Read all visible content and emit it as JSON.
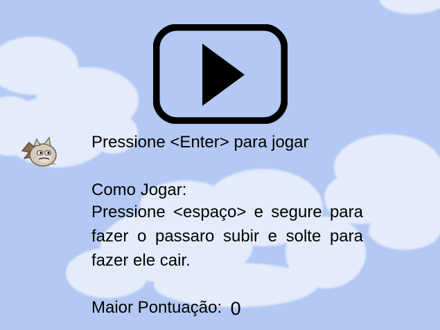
{
  "screen": {
    "type": "start-menu",
    "background_color": "#b3c9f3",
    "cloud_color": "#e4ebfa"
  },
  "play_button": {
    "icon": "play-icon",
    "outline_color": "#000000",
    "fill_color": "#b3c9f3"
  },
  "player": {
    "sprite": "bat-bird-icon"
  },
  "menu": {
    "start_prompt": "Pressione <Enter> para jogar",
    "how_to_title": "Como Jogar:",
    "how_to_body": "Pressione <espaço> e segure para fazer o passaro subir e solte para fazer ele cair.",
    "high_score_label": "Maior Pontuação:",
    "high_score_value": "0"
  }
}
